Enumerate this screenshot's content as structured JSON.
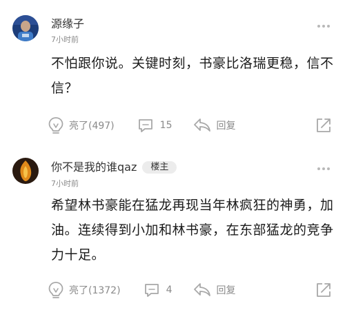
{
  "comments": [
    {
      "username": "源缘子",
      "badge": "",
      "time": "7小时前",
      "text": "不怕跟你说。关键时刻，书豪比洛瑞更稳，信不信？",
      "likes_label": "亮了(497)",
      "reply_count": "15",
      "reply_label": "回复",
      "avatar_colors": [
        "#1c3d7a",
        "#3f7cc8"
      ]
    },
    {
      "username": "你不是我的谁qaz",
      "badge": "楼主",
      "time": "7小时前",
      "text": "希望林书豪能在猛龙再现当年林疯狂的神勇，加油。连续得到小加和林书豪，在东部猛龙的竞争力十足。",
      "likes_label": "亮了(1372)",
      "reply_count": "4",
      "reply_label": "回复",
      "avatar_colors": [
        "#2a1a10",
        "#e08a1a"
      ]
    }
  ],
  "icons": {
    "like": "lightbulb-icon",
    "comment": "comment-bubble-icon",
    "reply": "reply-arrow-icon",
    "share": "share-icon",
    "more": "more-dots-icon"
  }
}
